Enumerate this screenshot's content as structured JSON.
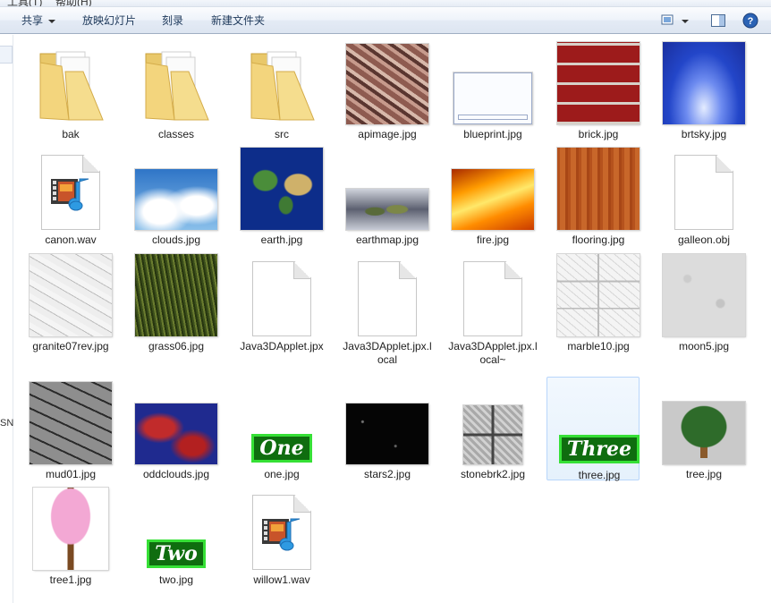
{
  "menubar": {
    "items": [
      "工具(T)",
      "帮助(H)"
    ]
  },
  "toolbar": {
    "share": "共享",
    "slideshow": "放映幻灯片",
    "burn": "刻录",
    "new_folder": "新建文件夹"
  },
  "nav_fragment": "SN",
  "accent": "#36e036",
  "files": [
    {
      "name": "bak",
      "kind": "folder"
    },
    {
      "name": "classes",
      "kind": "folder"
    },
    {
      "name": "src",
      "kind": "folder"
    },
    {
      "name": "apimage.jpg",
      "kind": "image"
    },
    {
      "name": "blueprint.jpg",
      "kind": "image"
    },
    {
      "name": "brick.jpg",
      "kind": "image"
    },
    {
      "name": "brtsky.jpg",
      "kind": "image"
    },
    {
      "name": "canon.wav",
      "kind": "audio"
    },
    {
      "name": "clouds.jpg",
      "kind": "image"
    },
    {
      "name": "earth.jpg",
      "kind": "image"
    },
    {
      "name": "earthmap.jpg",
      "kind": "image"
    },
    {
      "name": "fire.jpg",
      "kind": "image"
    },
    {
      "name": "flooring.jpg",
      "kind": "image"
    },
    {
      "name": "galleon.obj",
      "kind": "document"
    },
    {
      "name": "granite07rev.jpg",
      "kind": "image"
    },
    {
      "name": "grass06.jpg",
      "kind": "image"
    },
    {
      "name": "Java3DApplet.jpx",
      "kind": "document"
    },
    {
      "name": "Java3DApplet.jpx.local",
      "kind": "document"
    },
    {
      "name": "Java3DApplet.jpx.local~",
      "kind": "document"
    },
    {
      "name": "marble10.jpg",
      "kind": "image"
    },
    {
      "name": "moon5.jpg",
      "kind": "image"
    },
    {
      "name": "mud01.jpg",
      "kind": "image"
    },
    {
      "name": "oddclouds.jpg",
      "kind": "image"
    },
    {
      "name": "one.jpg",
      "kind": "image",
      "text": "One"
    },
    {
      "name": "stars2.jpg",
      "kind": "image"
    },
    {
      "name": "stonebrk2.jpg",
      "kind": "image"
    },
    {
      "name": "three.jpg",
      "kind": "image",
      "text": "Three",
      "selected": true
    },
    {
      "name": "tree.jpg",
      "kind": "image"
    },
    {
      "name": "tree1.jpg",
      "kind": "image"
    },
    {
      "name": "two.jpg",
      "kind": "image",
      "text": "Two"
    },
    {
      "name": "willow1.wav",
      "kind": "audio"
    }
  ]
}
